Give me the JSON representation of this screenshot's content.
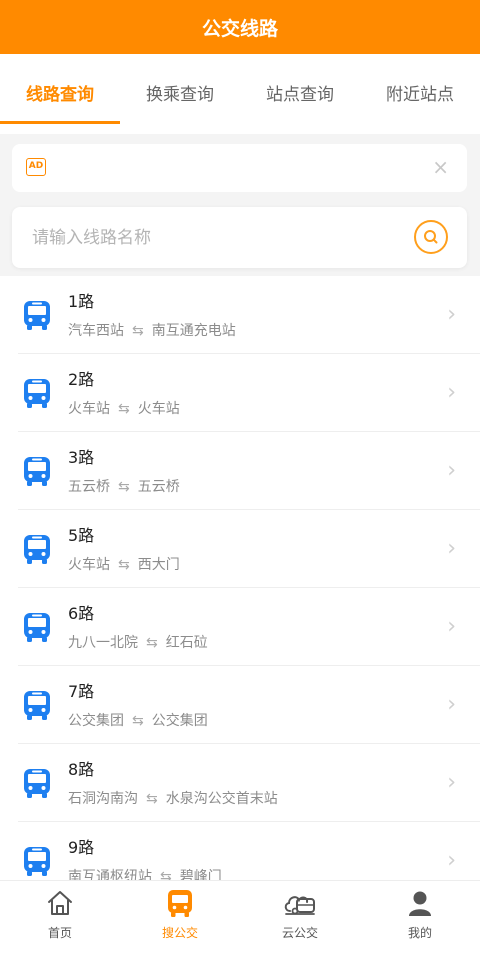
{
  "header": {
    "title": "公交线路"
  },
  "tabs": [
    {
      "label": "线路查询",
      "active": true
    },
    {
      "label": "换乘查询",
      "active": false
    },
    {
      "label": "站点查询",
      "active": false
    },
    {
      "label": "附近站点",
      "active": false
    }
  ],
  "ad": {
    "badge": "AD",
    "close": "×"
  },
  "search": {
    "placeholder": "请输入线路名称",
    "value": ""
  },
  "routes": [
    {
      "name": "1路",
      "from": "汽车西站",
      "to": "南互通充电站"
    },
    {
      "name": "2路",
      "from": "火车站",
      "to": "火车站"
    },
    {
      "name": "3路",
      "from": "五云桥",
      "to": "五云桥"
    },
    {
      "name": "5路",
      "from": "火车站",
      "to": "西大门"
    },
    {
      "name": "6路",
      "from": "九八一北院",
      "to": "红石砬"
    },
    {
      "name": "7路",
      "from": "公交集团",
      "to": "公交集团"
    },
    {
      "name": "8路",
      "from": "石洞沟南沟",
      "to": "水泉沟公交首末站"
    },
    {
      "name": "9路",
      "from": "南互通枢纽站",
      "to": "碧峰门"
    }
  ],
  "route_arrow": "⇆",
  "bottom_nav": [
    {
      "label": "首页",
      "icon": "home-icon",
      "active": false
    },
    {
      "label": "搜公交",
      "icon": "bus-icon",
      "active": true
    },
    {
      "label": "云公交",
      "icon": "cloud-bus-icon",
      "active": false
    },
    {
      "label": "我的",
      "icon": "profile-icon",
      "active": false
    }
  ],
  "colors": {
    "accent": "#ff8a00",
    "bus_icon": "#1e7ff0"
  }
}
